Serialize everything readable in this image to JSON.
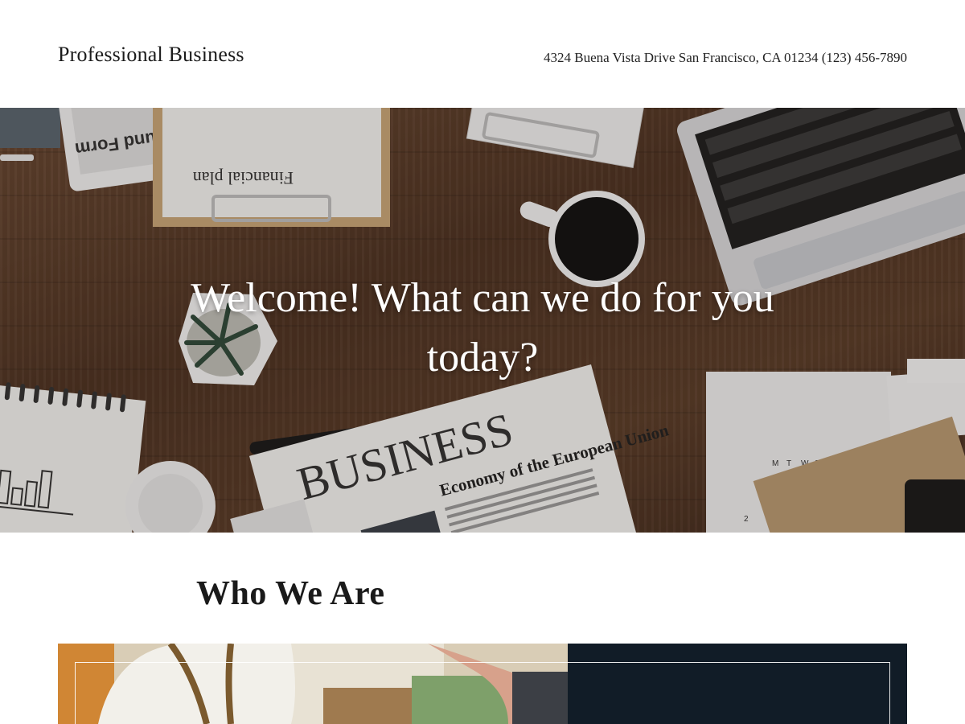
{
  "header": {
    "brand": "Professional Business",
    "contact": "4324 Buena Vista Drive San Francisco, CA 01234 (123) 456-7890"
  },
  "hero": {
    "title": "Welcome! What can we do for you today?",
    "image_text": {
      "tax_form": "Tax Refund Form",
      "financial_plan": "Financial plan",
      "newspaper_masthead": "BUSINESS",
      "headline": "Economy of the European Union"
    }
  },
  "section": {
    "title": "Who We Are"
  },
  "colors": {
    "navy_panel": "#111c27",
    "wood": "#5c3e2a",
    "text": "#1b1b1b"
  }
}
